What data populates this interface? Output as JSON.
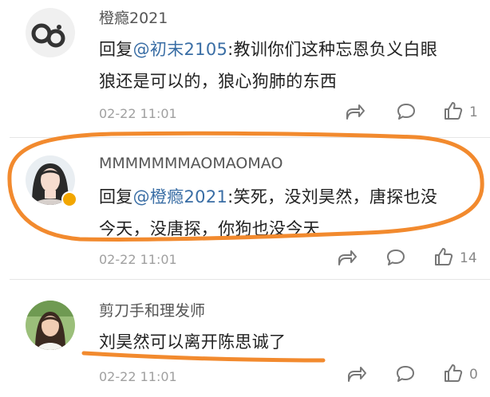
{
  "comments": [
    {
      "username": "橙瘾2021",
      "reply_prefix": "回复",
      "mention": "@初末2105",
      "text_line1": ":教训你们这种忘恩负义白眼",
      "text_line2": "狼还是可以的，狼心狗肺的东西",
      "time": "02-22 11:01",
      "likes": "1",
      "avatar_icon": "cartoon-logo-avatar"
    },
    {
      "username": "MMMMMMMAOMAOMAO",
      "reply_prefix": "回复",
      "mention": "@橙瘾2021",
      "text_line1": ":笑死，没刘昊然，唐探也没",
      "text_line2": "今天，没唐探，你狗也没今天",
      "time": "02-22 11:01",
      "likes": "14",
      "avatar_icon": "girl-portrait-avatar",
      "verified": true
    },
    {
      "username": "剪刀手和理发师",
      "text_line1": "刘昊然可以离开陈思诚了",
      "time": "02-22 11:01",
      "likes": "0",
      "avatar_icon": "girl-photo-avatar"
    }
  ],
  "colors": {
    "mention": "#3a6ea5",
    "annotation": "#f28a2e",
    "meta": "#a0a0a0"
  }
}
